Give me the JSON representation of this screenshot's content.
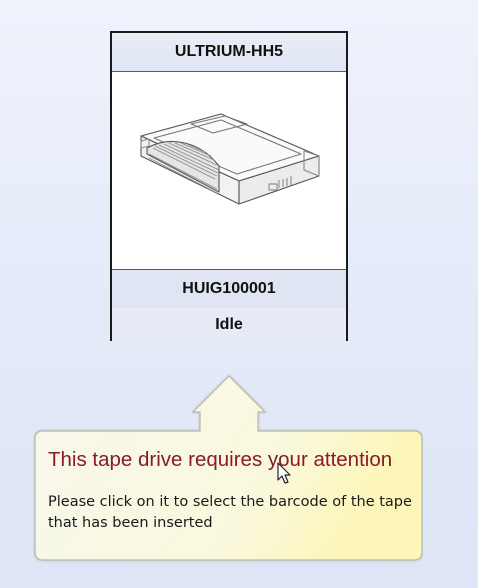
{
  "drive": {
    "model": "ULTRIUM-HH5",
    "barcode": "HUIG100001",
    "status": "Idle",
    "image_icon": "tape-drive-icon"
  },
  "callout": {
    "title": "This tape drive requires your attention",
    "message": "Please click on it to select the barcode of the tape that has been inserted",
    "colors": {
      "title": "#8b1a2a",
      "fill_start": "#f7f7ee",
      "fill_end": "#fdf9c8"
    }
  },
  "pointer": "mouse-cursor-icon"
}
